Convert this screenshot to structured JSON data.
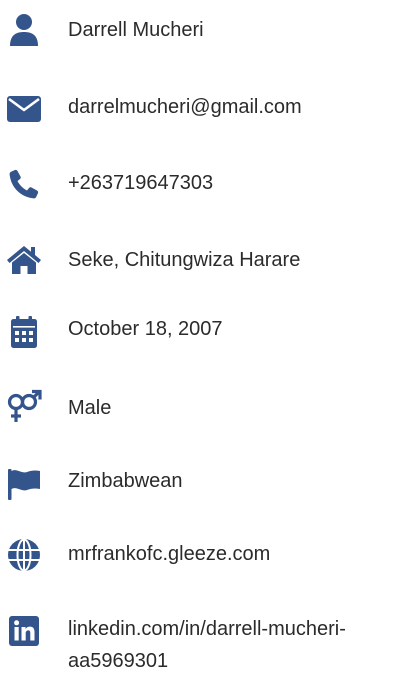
{
  "colors": {
    "icon": "#34558b",
    "text": "#2b2b2b",
    "background": "#ffffff"
  },
  "contact": {
    "items": [
      {
        "icon": "user-icon",
        "text": "Darrell Mucheri"
      },
      {
        "icon": "envelope-icon",
        "text": "darrelmucheri@gmail.com"
      },
      {
        "icon": "phone-icon",
        "text": "+263719647303"
      },
      {
        "icon": "home-icon",
        "text": "Seke, Chitungwiza Harare"
      },
      {
        "icon": "calendar-icon",
        "text": "October 18, 2007"
      },
      {
        "icon": "venus-mars-icon",
        "text": "Male"
      },
      {
        "icon": "flag-icon",
        "text": "Zimbabwean"
      },
      {
        "icon": "globe-icon",
        "text": "mrfrankofc.gleeze.com"
      },
      {
        "icon": "linkedin-icon",
        "text": "linkedin.com/in/darrell-mucheri-aa5969301"
      }
    ]
  }
}
